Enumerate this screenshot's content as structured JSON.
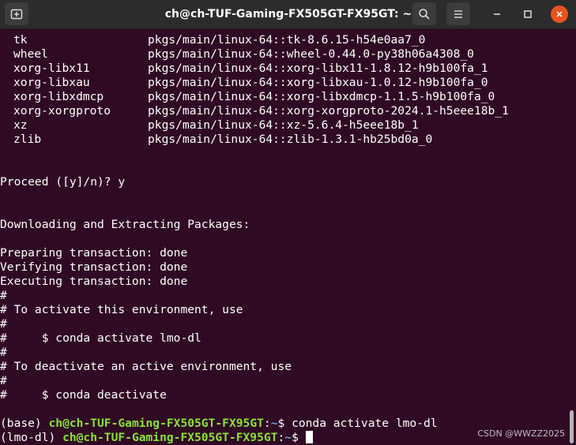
{
  "window": {
    "title": "ch@ch-TUF-Gaming-FX505GT-FX95GT: ~",
    "icons": [
      "new-tab-icon",
      "search-icon",
      "menu-icon",
      "minimize-icon",
      "maximize-icon",
      "close-icon"
    ]
  },
  "packages": [
    {
      "name": "tk",
      "source": "pkgs/main/linux-64::tk-8.6.15-h54e0aa7_0"
    },
    {
      "name": "wheel",
      "source": "pkgs/main/linux-64::wheel-0.44.0-py38h06a4308_0"
    },
    {
      "name": "xorg-libx11",
      "source": "pkgs/main/linux-64::xorg-libx11-1.8.12-h9b100fa_1"
    },
    {
      "name": "xorg-libxau",
      "source": "pkgs/main/linux-64::xorg-libxau-1.0.12-h9b100fa_0"
    },
    {
      "name": "xorg-libxdmcp",
      "source": "pkgs/main/linux-64::xorg-libxdmcp-1.1.5-h9b100fa_0"
    },
    {
      "name": "xorg-xorgproto",
      "source": "pkgs/main/linux-64::xorg-xorgproto-2024.1-h5eee18b_1"
    },
    {
      "name": "xz",
      "source": "pkgs/main/linux-64::xz-5.6.4-h5eee18b_1"
    },
    {
      "name": "zlib",
      "source": "pkgs/main/linux-64::zlib-1.3.1-hb25bd0a_0"
    }
  ],
  "output": {
    "proceed": "Proceed ([y]/n)? y",
    "downloading": "Downloading and Extracting Packages:",
    "preparing": "Preparing transaction: done",
    "verifying": "Verifying transaction: done",
    "executing": "Executing transaction: done",
    "c1": "#",
    "c2": "# To activate this environment, use",
    "c3": "#",
    "c4": "#     $ conda activate lmo-dl",
    "c5": "#",
    "c6": "# To deactivate an active environment, use",
    "c7": "#",
    "c8": "#     $ conda deactivate"
  },
  "prompt1": {
    "env": "(base) ",
    "userhost": "ch@ch-TUF-Gaming-FX505GT-FX95GT",
    "colon": ":",
    "path": "~",
    "symbol": "$ ",
    "command": "conda activate lmo-dl"
  },
  "prompt2": {
    "env": "(lmo-dl) ",
    "userhost": "ch@ch-TUF-Gaming-FX505GT-FX95GT",
    "colon": ":",
    "path": "~",
    "symbol": "$ "
  },
  "watermark": "CSDN @WWZZ2025",
  "colors": {
    "background": "#300a24",
    "titlebar": "#2c2c2c",
    "prompt_user": "#8ae234",
    "prompt_path": "#729fcf",
    "close_button": "#e95420"
  }
}
